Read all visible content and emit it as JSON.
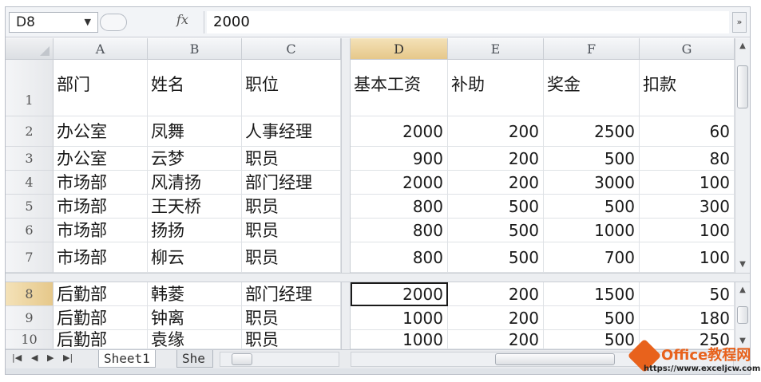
{
  "formula_bar": {
    "cell_ref": "D8",
    "fx_label": "fx",
    "value": "2000",
    "expand_glyph": "»"
  },
  "columns": [
    "A",
    "B",
    "C",
    "D",
    "E",
    "F",
    "G"
  ],
  "rows": [
    {
      "num": "1",
      "cells": [
        "部门",
        "姓名",
        "职位",
        "基本工资",
        "补助",
        "奖金",
        "扣款"
      ]
    },
    {
      "num": "2",
      "cells": [
        "办公室",
        "凤舞",
        "人事经理",
        "2000",
        "200",
        "2500",
        "60"
      ]
    },
    {
      "num": "3",
      "cells": [
        "办公室",
        "云梦",
        "职员",
        "900",
        "200",
        "500",
        "80"
      ]
    },
    {
      "num": "4",
      "cells": [
        "市场部",
        "风清扬",
        "部门经理",
        "2000",
        "200",
        "3000",
        "100"
      ]
    },
    {
      "num": "5",
      "cells": [
        "市场部",
        "王天桥",
        "职员",
        "800",
        "500",
        "500",
        "300"
      ]
    },
    {
      "num": "6",
      "cells": [
        "市场部",
        "扬扬",
        "职员",
        "800",
        "500",
        "1000",
        "100"
      ]
    },
    {
      "num": "7",
      "cells": [
        "市场部",
        "柳云",
        "职员",
        "800",
        "500",
        "700",
        "100"
      ]
    },
    {
      "num": "8",
      "cells": [
        "后勤部",
        "韩菱",
        "部门经理",
        "2000",
        "200",
        "1500",
        "50"
      ]
    },
    {
      "num": "9",
      "cells": [
        "后勤部",
        "钟离",
        "职员",
        "1000",
        "200",
        "500",
        "180"
      ]
    },
    {
      "num": "10",
      "cells": [
        "后勤部",
        "袁缘",
        "职员",
        "1000",
        "200",
        "500",
        "250"
      ]
    }
  ],
  "active_cell": "D8",
  "sheet_tabs": [
    "Sheet1",
    "She"
  ],
  "watermark": {
    "name": "Office教程网",
    "url": "https://www.exceljcw.com"
  },
  "colors": {
    "header_selected": "#e6c88a",
    "brand": "#e8621c"
  }
}
